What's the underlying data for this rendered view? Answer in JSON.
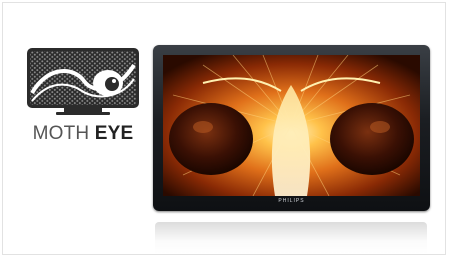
{
  "logo": {
    "icon": "moth-eye-logo-icon",
    "text_light": "MOTH",
    "text_bold": "EYE"
  },
  "tv": {
    "brand": "PHILIPS",
    "screen_image": "moth-face-closeup"
  },
  "colors": {
    "logo_dark": "#2b2b2b",
    "bezel": "#1b1e22",
    "screen_glow": "#ffb23a"
  }
}
